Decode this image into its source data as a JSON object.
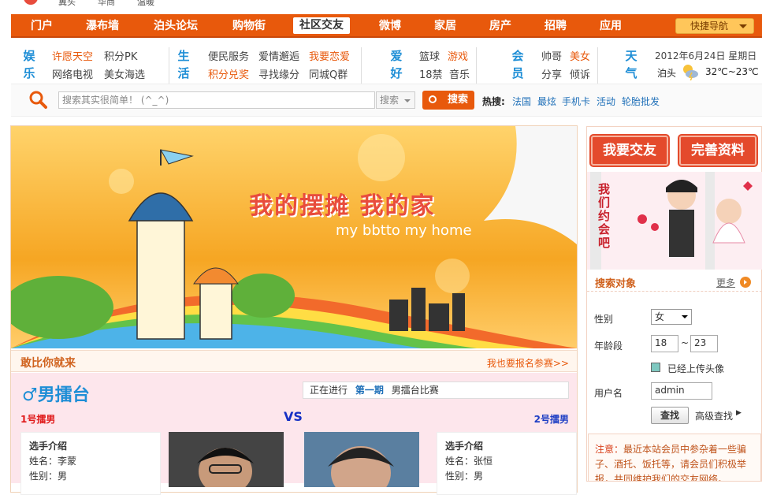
{
  "top_strip": {
    "items": [
      "冀头",
      "华商",
      "温暖"
    ]
  },
  "nav": {
    "items": [
      "门户",
      "瀑布墙",
      "泊头论坛",
      "购物街",
      "社区交友",
      "微博",
      "家居",
      "房产",
      "招聘",
      "应用"
    ],
    "active": "社区交友",
    "quick_nav": "快捷导航"
  },
  "categories": {
    "entertainment": {
      "head": [
        "娱",
        "乐"
      ],
      "links": [
        "许愿天空",
        "积分PK",
        "网络电视",
        "美女海选"
      ]
    },
    "life": {
      "head": [
        "生",
        "活"
      ],
      "links": [
        "便民服务",
        "爱情邂逅",
        "我要恋爱",
        "积分兑奖",
        "寻找缘分",
        "同城Q群"
      ]
    },
    "hobby": {
      "head": [
        "爱",
        "好"
      ],
      "links": [
        "篮球",
        "游戏",
        "18禁",
        "音乐"
      ]
    },
    "member": {
      "head": [
        "会",
        "员"
      ],
      "links": [
        "帅哥",
        "美女",
        "分享",
        "倾诉"
      ]
    },
    "weather": {
      "head": [
        "天",
        "气"
      ],
      "date": "2012年6月24日 星期日",
      "city": "泊头",
      "temp": "32℃~23℃"
    }
  },
  "search": {
    "placeholder": "搜索其实很简单！ (^_^)",
    "type": "搜索",
    "button": "搜索",
    "hot_label": "热搜:",
    "hot_words": [
      "法国",
      "最炫",
      "手机卡",
      "活动",
      "轮胎批发"
    ]
  },
  "banner": {
    "title": "我的摆摊 我的家",
    "subtitle": "my bbtto my home"
  },
  "challenge": {
    "title": "敢比你就来",
    "signup": "我也要报名参赛>>"
  },
  "arena": {
    "title": "♂男擂台",
    "status_prefix": "正在进行",
    "status_round": "第一期",
    "status_text": "男擂台比赛",
    "left_label": "1号擂男",
    "vs": "VS",
    "right_label": "2号擂男",
    "left_player": {
      "intro": "选手介绍",
      "name": "姓名：李蒙",
      "gender": "性别：男"
    },
    "right_player": {
      "intro": "选手介绍",
      "name": "姓名：张恒",
      "gender": "性别：男"
    }
  },
  "sidebar": {
    "make_friends": "我要交友",
    "complete_profile": "完善资料",
    "love_text": "我们约会吧",
    "search_title": "搜索对象",
    "more": "更多",
    "gender_label": "性别",
    "gender_value": "女",
    "age_label": "年龄段",
    "age_from": "18",
    "age_sep": "~",
    "age_to": "23",
    "avatar_check": "已经上传头像",
    "user_label": "用户名",
    "user_value": "admin",
    "search_btn": "查找",
    "advanced": "高级查找",
    "notice_label": "注意：",
    "notice_text": "最近本站会员中参杂着一些骗子、酒托、饭托等，请会员们积极举报，共同维护我们的交友网络。"
  },
  "colors": {
    "brand": "#e8590c",
    "blue": "#1e8ed6",
    "pink": "#fde6ec",
    "red": "#e44a2c"
  }
}
